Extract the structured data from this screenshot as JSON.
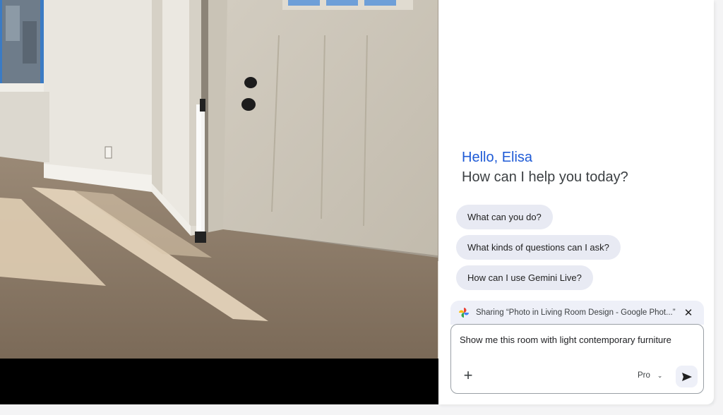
{
  "photo": {
    "description_icon": "photo-of-room-icon"
  },
  "panel": {
    "greeting_hello": "Hello, Elisa",
    "greeting_help": "How can I help you today?",
    "suggestions": [
      "What can you do?",
      "What kinds of questions can I ask?",
      "How can I use Gemini Live?"
    ],
    "sharing_text": "Sharing “Photo in Living Room Design - Google Phot...”",
    "close_label": "✕",
    "input_value": "Show me this room with light contemporary furniture",
    "plus_label": "+",
    "model_label": "Pro",
    "model_chevron": "⌄",
    "accent_color": "#1f5bd6",
    "chip_color": "#e8eaf3"
  }
}
